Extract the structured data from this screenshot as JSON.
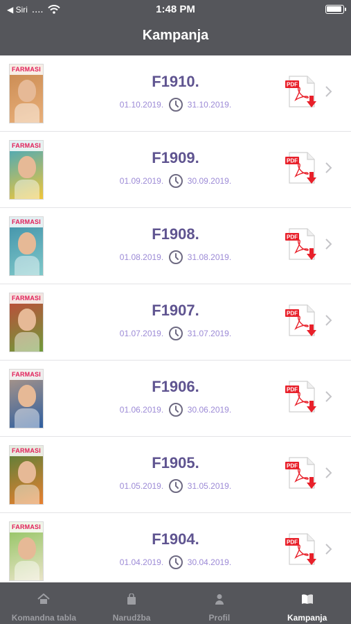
{
  "status_bar": {
    "back_label": "◀ Siri",
    "signal": "....",
    "time": "1:48 PM"
  },
  "nav": {
    "title": "Kampanja"
  },
  "campaigns": [
    {
      "name": "F1910.",
      "start": "01.10.2019.",
      "end": "31.10.2019.",
      "cover_brand": "FARMASI",
      "cover_color": "#c8884f",
      "cover_accent": "#e9b07a"
    },
    {
      "name": "F1909.",
      "start": "01.09.2019.",
      "end": "30.09.2019.",
      "cover_brand": "FARMASI",
      "cover_color": "#3aa6c4",
      "cover_accent": "#f1c63a"
    },
    {
      "name": "F1908.",
      "start": "01.08.2019.",
      "end": "31.08.2019.",
      "cover_brand": "FARMASI",
      "cover_color": "#3e8fa8",
      "cover_accent": "#7fc8c9"
    },
    {
      "name": "F1907.",
      "start": "01.07.2019.",
      "end": "31.07.2019.",
      "cover_brand": "FARMASI",
      "cover_color": "#c5443a",
      "cover_accent": "#6f9b3a"
    },
    {
      "name": "F1906.",
      "start": "01.06.2019.",
      "end": "30.06.2019.",
      "cover_brand": "FARMASI",
      "cover_color": "#b59a86",
      "cover_accent": "#2f5fa0"
    },
    {
      "name": "F1905.",
      "start": "01.05.2019.",
      "end": "31.05.2019.",
      "cover_brand": "FARMASI",
      "cover_color": "#4e7f3a",
      "cover_accent": "#e9802f"
    },
    {
      "name": "F1904.",
      "start": "01.04.2019.",
      "end": "30.04.2019.",
      "cover_brand": "FARMASI",
      "cover_color": "#8cc15a",
      "cover_accent": "#e9e4c8"
    }
  ],
  "pdf_badge": "PDF",
  "tabs": [
    {
      "label": "Komandna tabla",
      "icon": "home-icon",
      "active": false
    },
    {
      "label": "Narudžba",
      "icon": "shopping-bag-icon",
      "active": false
    },
    {
      "label": "Profil",
      "icon": "person-icon",
      "active": false
    },
    {
      "label": "Kampanja",
      "icon": "book-icon",
      "active": true
    }
  ],
  "colors": {
    "bar_background": "#55565b",
    "campaign_name": "#5f5490",
    "date_text": "#9c8ad6",
    "pdf_red": "#e8202a",
    "tab_inactive": "#9d9ea3",
    "tab_active": "#ffffff"
  }
}
